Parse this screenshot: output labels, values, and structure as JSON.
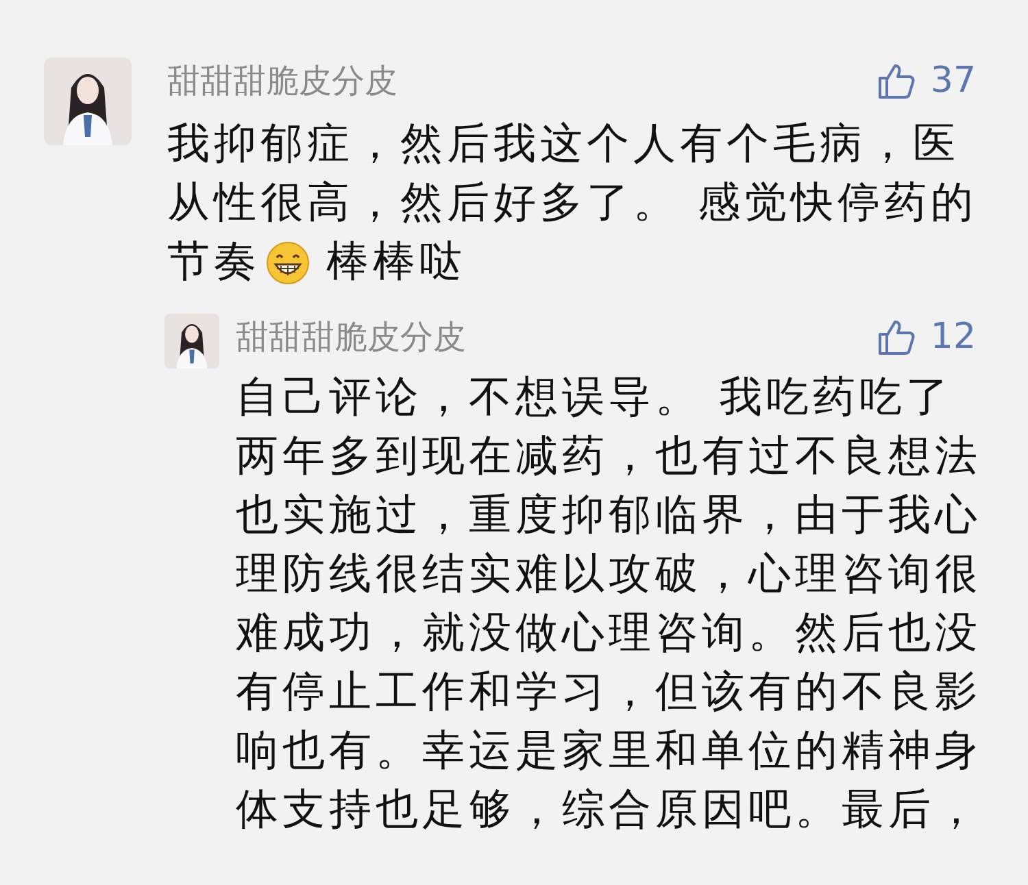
{
  "comments": [
    {
      "author": "甜甜甜脆皮分皮",
      "likes": "37",
      "lines": [
        [
          {
            "kind": "text",
            "text": "我抑郁症，然后我这个人有个毛病，医"
          }
        ],
        [
          {
            "kind": "text",
            "text": "从性很高，然后好多了。 感觉快停药的"
          }
        ],
        [
          {
            "kind": "text",
            "text": "节奏"
          },
          {
            "kind": "emoji"
          },
          {
            "kind": "text",
            "text": "棒棒哒"
          }
        ]
      ],
      "replies": [
        {
          "author": "甜甜甜脆皮分皮",
          "likes": "12",
          "lines": [
            [
              {
                "kind": "text",
                "text": "自己评论，不想误导。 我吃药吃了"
              }
            ],
            [
              {
                "kind": "text",
                "text": "两年多到现在减药，也有过不良想法"
              }
            ],
            [
              {
                "kind": "text",
                "text": "也实施过，重度抑郁临界，由于我心"
              }
            ],
            [
              {
                "kind": "text",
                "text": "理防线很结实难以攻破，心理咨询很"
              }
            ],
            [
              {
                "kind": "text",
                "text": "难成功，就没做心理咨询。然后也没"
              }
            ],
            [
              {
                "kind": "text",
                "text": "有停止工作和学习，但该有的不良影"
              }
            ],
            [
              {
                "kind": "text",
                "text": "响也有。幸运是家里和单位的精神身"
              }
            ],
            [
              {
                "kind": "text",
                "text": "体支持也足够，综合原因吧。最后，"
              }
            ]
          ]
        }
      ]
    }
  ]
}
